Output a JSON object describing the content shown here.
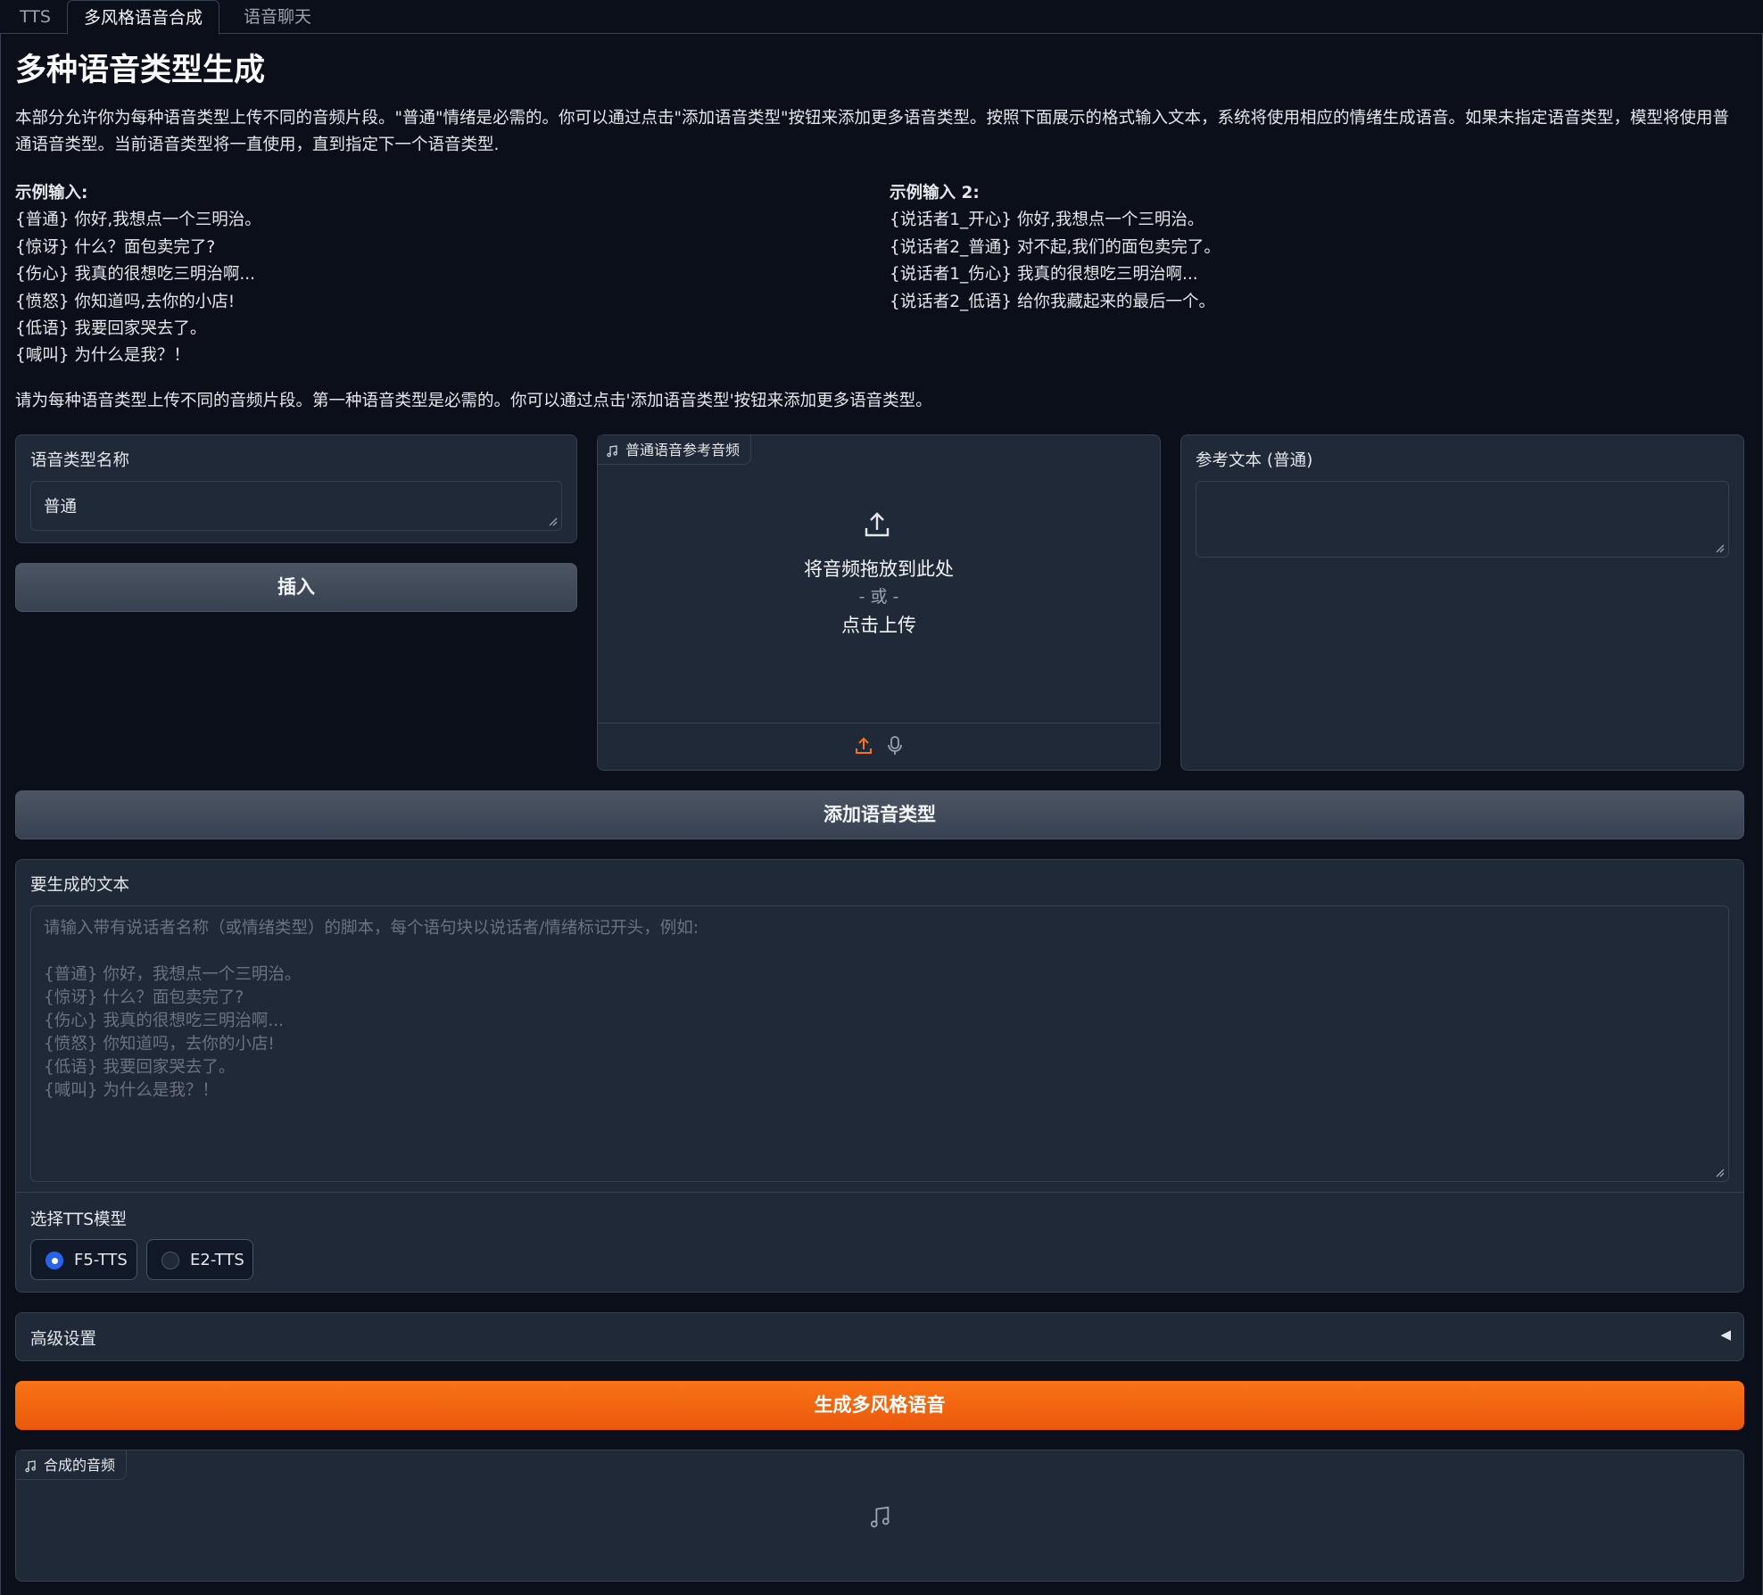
{
  "tabs": [
    "TTS",
    "多风格语音合成",
    "语音聊天"
  ],
  "active_tab": 1,
  "title": "多种语音类型生成",
  "description": "本部分允许你为每种语音类型上传不同的音频片段。\"普通\"情绪是必需的。你可以通过点击\"添加语音类型\"按钮来添加更多语音类型。按照下面展示的格式输入文本，系统将使用相应的情绪生成语音。如果未指定语音类型，模型将使用普通语音类型。当前语音类型将一直使用，直到指定下一个语音类型.",
  "example1": {
    "heading": "示例输入:",
    "lines": [
      "{普通} 你好,我想点一个三明治。",
      "{惊讶} 什么？面包卖完了?",
      "{伤心} 我真的很想吃三明治啊...",
      "{愤怒} 你知道吗,去你的小店!",
      "{低语} 我要回家哭去了。",
      "{喊叫} 为什么是我？！"
    ]
  },
  "example2": {
    "heading": "示例输入 2:",
    "lines": [
      "{说话者1_开心} 你好,我想点一个三明治。",
      "{说话者2_普通} 对不起,我们的面包卖完了。",
      "{说话者1_伤心} 我真的很想吃三明治啊...",
      "{说话者2_低语} 给你我藏起来的最后一个。"
    ]
  },
  "note": "请为每种语音类型上传不同的音频片段。第一种语音类型是必需的。你可以通过点击'添加语音类型'按钮来添加更多语音类型。",
  "speech_type": {
    "label": "语音类型名称",
    "value": "普通",
    "insert_button": "插入"
  },
  "ref_audio": {
    "chip_label": "普通语音参考音频",
    "drop_text": "将音频拖放到此处",
    "or_text": "- 或 -",
    "click_text": "点击上传"
  },
  "ref_text": {
    "label": "参考文本 (普通)",
    "value": ""
  },
  "add_type_button": "添加语音类型",
  "gen_text": {
    "label": "要生成的文本",
    "placeholder": "请输入带有说话者名称（或情绪类型）的脚本，每个语句块以说话者/情绪标记开头，例如:\n\n{普通} 你好，我想点一个三明治。\n{惊讶} 什么？面包卖完了?\n{伤心} 我真的很想吃三明治啊...\n{愤怒} 你知道吗，去你的小店!\n{低语} 我要回家哭去了。\n{喊叫} 为什么是我？！"
  },
  "model_select": {
    "label": "选择TTS模型",
    "options": [
      "F5-TTS",
      "E2-TTS"
    ],
    "selected": "F5-TTS"
  },
  "advanced": {
    "label": "高级设置",
    "arrow": "◀"
  },
  "generate_button": "生成多风格语音",
  "output_audio": {
    "chip_label": "合成的音频"
  },
  "colors": {
    "background": "#0b0f19",
    "panel": "#1f2937",
    "border": "#374151",
    "accent": "#f97316",
    "radio_selected": "#2563eb"
  },
  "icons": [
    "music-note-icon",
    "upload-icon",
    "microphone-icon",
    "resize-handle-icon"
  ]
}
